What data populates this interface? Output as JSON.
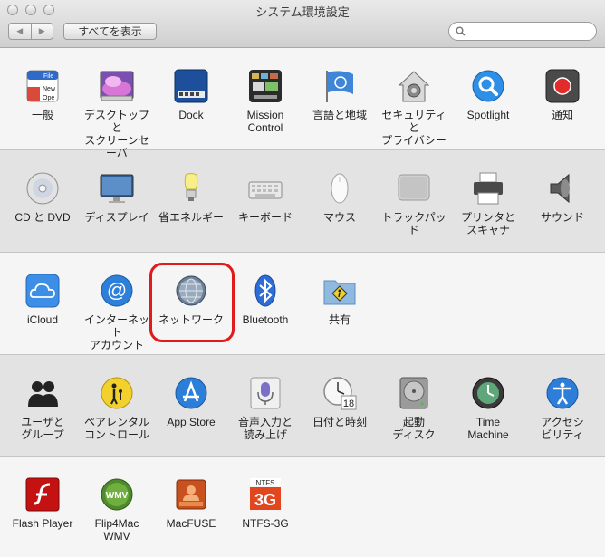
{
  "window": {
    "title": "システム環境設定",
    "show_all": "すべてを表示",
    "back": "◀",
    "forward": "▶",
    "search_placeholder": ""
  },
  "rows": [
    {
      "panes": [
        {
          "name": "general",
          "label": "一般",
          "icon": "general-icon"
        },
        {
          "name": "desktop",
          "label": "デスクトップと\nスクリーンセーバ",
          "icon": "desktop-icon"
        },
        {
          "name": "dock",
          "label": "Dock",
          "icon": "dock-icon"
        },
        {
          "name": "mission-control",
          "label": "Mission\nControl",
          "icon": "mission-control-icon"
        },
        {
          "name": "language",
          "label": "言語と地域",
          "icon": "flag-icon"
        },
        {
          "name": "security",
          "label": "セキュリティと\nプライバシー",
          "icon": "house-lock-icon"
        },
        {
          "name": "spotlight",
          "label": "Spotlight",
          "icon": "magnifier-icon"
        },
        {
          "name": "notifications",
          "label": "通知",
          "icon": "notification-icon"
        }
      ]
    },
    {
      "panes": [
        {
          "name": "cd-dvd",
          "label": "CD と DVD",
          "icon": "disc-icon"
        },
        {
          "name": "displays",
          "label": "ディスプレイ",
          "icon": "display-icon"
        },
        {
          "name": "energy",
          "label": "省エネルギー",
          "icon": "bulb-icon"
        },
        {
          "name": "keyboard",
          "label": "キーボード",
          "icon": "keyboard-icon"
        },
        {
          "name": "mouse",
          "label": "マウス",
          "icon": "mouse-icon"
        },
        {
          "name": "trackpad",
          "label": "トラックパッド",
          "icon": "trackpad-icon"
        },
        {
          "name": "printers",
          "label": "プリンタと\nスキャナ",
          "icon": "printer-icon"
        },
        {
          "name": "sound",
          "label": "サウンド",
          "icon": "speaker-icon"
        }
      ]
    },
    {
      "panes": [
        {
          "name": "icloud",
          "label": "iCloud",
          "icon": "cloud-icon"
        },
        {
          "name": "internet-accounts",
          "label": "インターネット\nアカウント",
          "icon": "at-icon"
        },
        {
          "name": "network",
          "label": "ネットワーク",
          "icon": "globe-icon"
        },
        {
          "name": "bluetooth",
          "label": "Bluetooth",
          "icon": "bluetooth-icon"
        },
        {
          "name": "sharing",
          "label": "共有",
          "icon": "sharing-folder-icon"
        }
      ]
    },
    {
      "panes": [
        {
          "name": "users",
          "label": "ユーザと\nグループ",
          "icon": "users-icon"
        },
        {
          "name": "parental",
          "label": "ペアレンタル\nコントロール",
          "icon": "parental-icon"
        },
        {
          "name": "app-store",
          "label": "App Store",
          "icon": "app-store-icon"
        },
        {
          "name": "dictation",
          "label": "音声入力と\n読み上げ",
          "icon": "microphone-icon"
        },
        {
          "name": "date-time",
          "label": "日付と時刻",
          "icon": "clock-icon"
        },
        {
          "name": "startup-disk",
          "label": "起動\nディスク",
          "icon": "hard-drive-icon"
        },
        {
          "name": "time-machine",
          "label": "Time\nMachine",
          "icon": "time-machine-icon"
        },
        {
          "name": "accessibility",
          "label": "アクセシ\nビリティ",
          "icon": "accessibility-icon"
        }
      ]
    },
    {
      "panes": [
        {
          "name": "flash-player",
          "label": "Flash Player",
          "icon": "flash-icon"
        },
        {
          "name": "flip4mac",
          "label": "Flip4Mac\nWMV",
          "icon": "wmv-icon"
        },
        {
          "name": "macfuse",
          "label": "MacFUSE",
          "icon": "macfuse-icon"
        },
        {
          "name": "ntfs-3g",
          "label": "NTFS-3G",
          "icon": "ntfs-icon"
        }
      ]
    }
  ],
  "icon_badges": {
    "general_file": "File",
    "general_new": "New",
    "general_ope": "Ope",
    "clock_date": "18",
    "wmv": "WMV",
    "ntfs_top": "NTFS",
    "ntfs_main": "3G",
    "at": "@"
  }
}
